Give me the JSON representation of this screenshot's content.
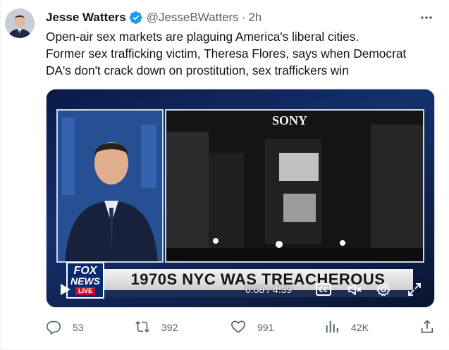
{
  "author": {
    "name": "Jesse Watters",
    "handle": "@JesseBWatters",
    "separator": "·",
    "time": "2h"
  },
  "tweet": {
    "lines": [
      "Open-air sex markets are plaguing America's liberal cities.",
      "Former sex trafficking victim, Theresa Flores, says when Democrat",
      "DA's don't crack down on prostitution, sex traffickers win"
    ]
  },
  "video": {
    "lower_third": "1970S NYC WAS TREACHEROUS",
    "logo_line1": "FOX",
    "logo_line2": "NEWS",
    "logo_line3": "LIVE",
    "marquee_sign": "SONY",
    "timecode": "0:08 / 4:39"
  },
  "actions": {
    "replies": "53",
    "retweets": "392",
    "likes": "991",
    "views": "42K"
  },
  "colors": {
    "verified": "#1d9bf0",
    "muted_text": "#536471",
    "text": "#0f1419"
  },
  "icons": [
    "verified-badge-icon",
    "more-icon",
    "play-icon",
    "captions-icon",
    "mute-icon",
    "settings-icon",
    "fullscreen-icon",
    "reply-icon",
    "retweet-icon",
    "like-icon",
    "views-icon",
    "share-icon"
  ]
}
